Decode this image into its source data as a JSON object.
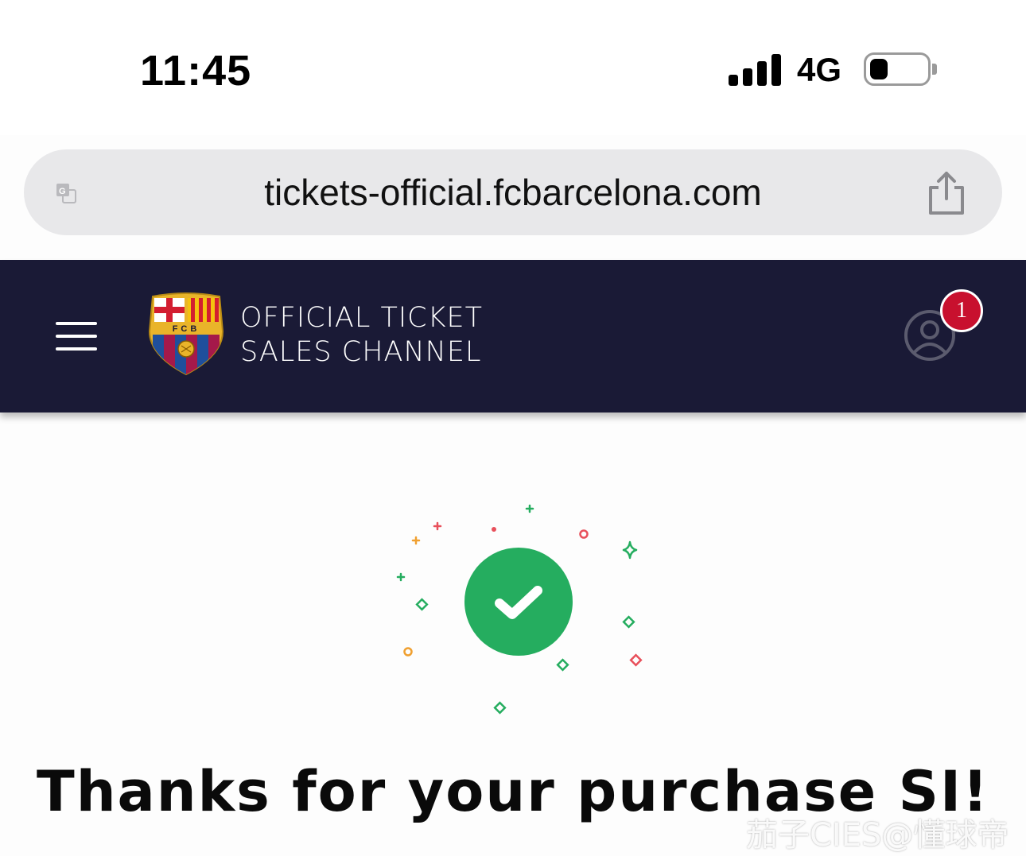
{
  "status_bar": {
    "time": "11:45",
    "network": "4G",
    "signal_bars": 4,
    "battery_level": 0.3
  },
  "browser": {
    "url": "tickets-official.fcbarcelona.com",
    "icons": [
      "translate-icon",
      "share-icon"
    ]
  },
  "header": {
    "brand_line1": "OFFICIAL TICKET",
    "brand_line2": "SALES CHANNEL",
    "crest_text": "FCB",
    "badge_count": "1",
    "colors": {
      "background": "#1a1a36",
      "badge": "#c8102e"
    }
  },
  "main": {
    "success_color": "#25ad5f",
    "heading": "Thanks for your purchase SI!"
  },
  "watermark": "茄子CIES@懂球帝"
}
